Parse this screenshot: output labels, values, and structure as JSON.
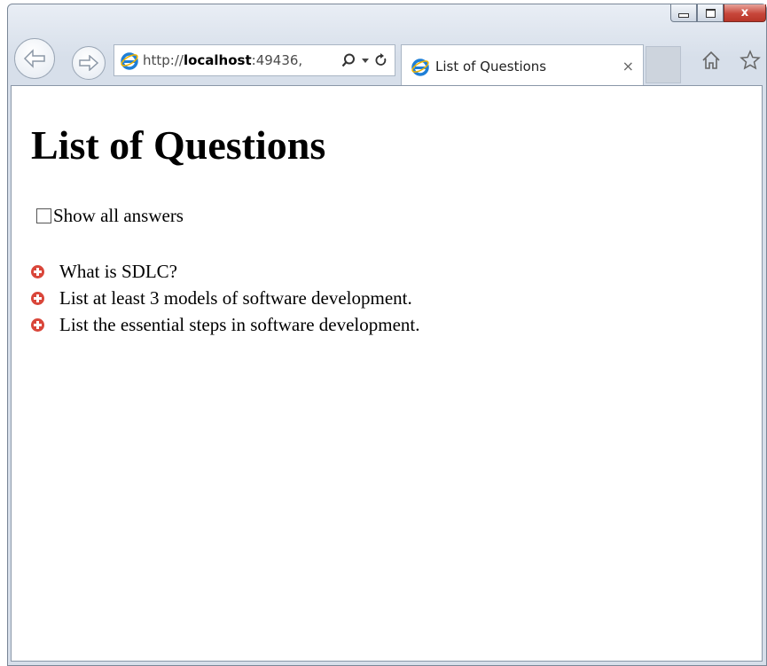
{
  "browser": {
    "address": {
      "scheme": "http://",
      "host": "localhost",
      "port": ":49436,"
    },
    "tab": {
      "title": "List of Questions",
      "close": "×"
    },
    "window_controls": {
      "close": "x"
    },
    "icons": {
      "back": "back-arrow-icon",
      "forward": "forward-arrow-icon",
      "search": "search-icon",
      "refresh": "refresh-icon",
      "home": "home-icon",
      "favorites": "star-icon"
    }
  },
  "page": {
    "title": "List of Questions",
    "show_all_label": "Show all answers",
    "show_all_checked": false,
    "questions": [
      "What is SDLC?",
      "List at least 3 models of software development.",
      "List the essential steps in software development."
    ],
    "accent_color": "#d9463a"
  }
}
